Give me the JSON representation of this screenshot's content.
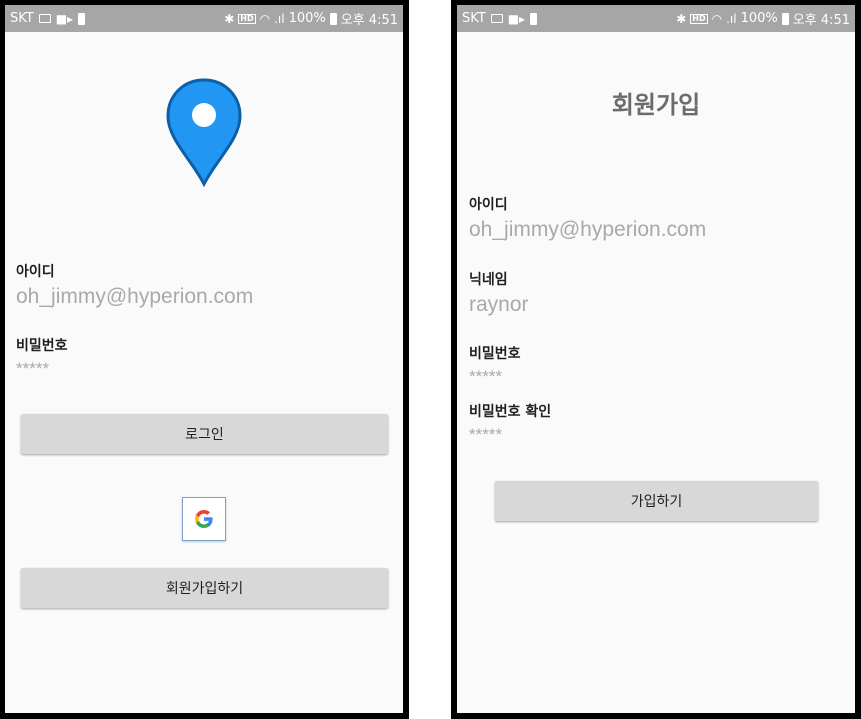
{
  "status_bar": {
    "carrier": "SKT",
    "battery_percent": "100%",
    "time": "오후 4:51",
    "hd_badge": "HD"
  },
  "login_screen": {
    "id_label": "아이디",
    "id_value": "oh_jimmy@hyperion.com",
    "password_label": "비밀번호",
    "password_value": "*****",
    "login_button": "로그인",
    "signup_button": "회원가입하기",
    "google_letter": "G"
  },
  "signup_screen": {
    "title": "회원가입",
    "id_label": "아이디",
    "id_value": "oh_jimmy@hyperion.com",
    "nickname_label": "닉네임",
    "nickname_value": "raynor",
    "password_label": "비밀번호",
    "password_value": "*****",
    "password_confirm_label": "비밀번호 확인",
    "password_confirm_value": "*****",
    "submit_button": "가입하기"
  },
  "colors": {
    "pin_blue": "#2196f3",
    "status_bar_bg": "#a6a6a6",
    "button_bg": "#d8d8d8"
  }
}
